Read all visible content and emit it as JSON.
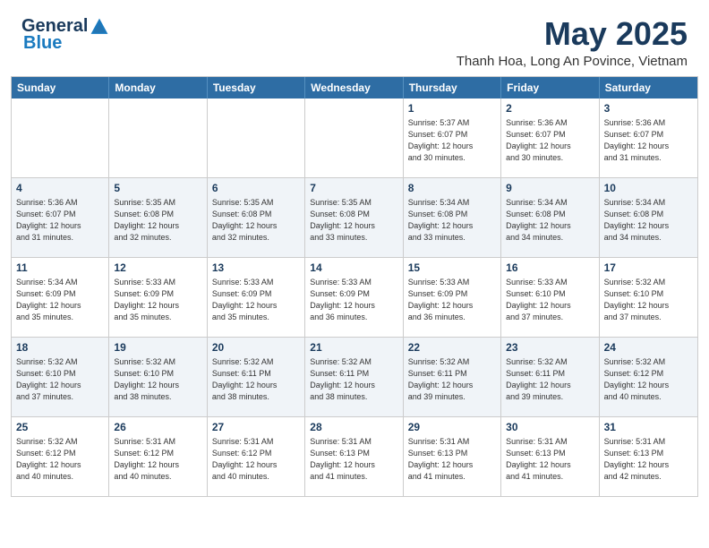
{
  "header": {
    "logo": {
      "general": "General",
      "blue": "Blue"
    },
    "title": "May 2025",
    "subtitle": "Thanh Hoa, Long An Povince, Vietnam"
  },
  "calendar": {
    "days_of_week": [
      "Sunday",
      "Monday",
      "Tuesday",
      "Wednesday",
      "Thursday",
      "Friday",
      "Saturday"
    ],
    "weeks": [
      [
        {
          "day": "",
          "info": ""
        },
        {
          "day": "",
          "info": ""
        },
        {
          "day": "",
          "info": ""
        },
        {
          "day": "",
          "info": ""
        },
        {
          "day": "1",
          "info": "Sunrise: 5:37 AM\nSunset: 6:07 PM\nDaylight: 12 hours\nand 30 minutes."
        },
        {
          "day": "2",
          "info": "Sunrise: 5:36 AM\nSunset: 6:07 PM\nDaylight: 12 hours\nand 30 minutes."
        },
        {
          "day": "3",
          "info": "Sunrise: 5:36 AM\nSunset: 6:07 PM\nDaylight: 12 hours\nand 31 minutes."
        }
      ],
      [
        {
          "day": "4",
          "info": "Sunrise: 5:36 AM\nSunset: 6:07 PM\nDaylight: 12 hours\nand 31 minutes."
        },
        {
          "day": "5",
          "info": "Sunrise: 5:35 AM\nSunset: 6:08 PM\nDaylight: 12 hours\nand 32 minutes."
        },
        {
          "day": "6",
          "info": "Sunrise: 5:35 AM\nSunset: 6:08 PM\nDaylight: 12 hours\nand 32 minutes."
        },
        {
          "day": "7",
          "info": "Sunrise: 5:35 AM\nSunset: 6:08 PM\nDaylight: 12 hours\nand 33 minutes."
        },
        {
          "day": "8",
          "info": "Sunrise: 5:34 AM\nSunset: 6:08 PM\nDaylight: 12 hours\nand 33 minutes."
        },
        {
          "day": "9",
          "info": "Sunrise: 5:34 AM\nSunset: 6:08 PM\nDaylight: 12 hours\nand 34 minutes."
        },
        {
          "day": "10",
          "info": "Sunrise: 5:34 AM\nSunset: 6:08 PM\nDaylight: 12 hours\nand 34 minutes."
        }
      ],
      [
        {
          "day": "11",
          "info": "Sunrise: 5:34 AM\nSunset: 6:09 PM\nDaylight: 12 hours\nand 35 minutes."
        },
        {
          "day": "12",
          "info": "Sunrise: 5:33 AM\nSunset: 6:09 PM\nDaylight: 12 hours\nand 35 minutes."
        },
        {
          "day": "13",
          "info": "Sunrise: 5:33 AM\nSunset: 6:09 PM\nDaylight: 12 hours\nand 35 minutes."
        },
        {
          "day": "14",
          "info": "Sunrise: 5:33 AM\nSunset: 6:09 PM\nDaylight: 12 hours\nand 36 minutes."
        },
        {
          "day": "15",
          "info": "Sunrise: 5:33 AM\nSunset: 6:09 PM\nDaylight: 12 hours\nand 36 minutes."
        },
        {
          "day": "16",
          "info": "Sunrise: 5:33 AM\nSunset: 6:10 PM\nDaylight: 12 hours\nand 37 minutes."
        },
        {
          "day": "17",
          "info": "Sunrise: 5:32 AM\nSunset: 6:10 PM\nDaylight: 12 hours\nand 37 minutes."
        }
      ],
      [
        {
          "day": "18",
          "info": "Sunrise: 5:32 AM\nSunset: 6:10 PM\nDaylight: 12 hours\nand 37 minutes."
        },
        {
          "day": "19",
          "info": "Sunrise: 5:32 AM\nSunset: 6:10 PM\nDaylight: 12 hours\nand 38 minutes."
        },
        {
          "day": "20",
          "info": "Sunrise: 5:32 AM\nSunset: 6:11 PM\nDaylight: 12 hours\nand 38 minutes."
        },
        {
          "day": "21",
          "info": "Sunrise: 5:32 AM\nSunset: 6:11 PM\nDaylight: 12 hours\nand 38 minutes."
        },
        {
          "day": "22",
          "info": "Sunrise: 5:32 AM\nSunset: 6:11 PM\nDaylight: 12 hours\nand 39 minutes."
        },
        {
          "day": "23",
          "info": "Sunrise: 5:32 AM\nSunset: 6:11 PM\nDaylight: 12 hours\nand 39 minutes."
        },
        {
          "day": "24",
          "info": "Sunrise: 5:32 AM\nSunset: 6:12 PM\nDaylight: 12 hours\nand 40 minutes."
        }
      ],
      [
        {
          "day": "25",
          "info": "Sunrise: 5:32 AM\nSunset: 6:12 PM\nDaylight: 12 hours\nand 40 minutes."
        },
        {
          "day": "26",
          "info": "Sunrise: 5:31 AM\nSunset: 6:12 PM\nDaylight: 12 hours\nand 40 minutes."
        },
        {
          "day": "27",
          "info": "Sunrise: 5:31 AM\nSunset: 6:12 PM\nDaylight: 12 hours\nand 40 minutes."
        },
        {
          "day": "28",
          "info": "Sunrise: 5:31 AM\nSunset: 6:13 PM\nDaylight: 12 hours\nand 41 minutes."
        },
        {
          "day": "29",
          "info": "Sunrise: 5:31 AM\nSunset: 6:13 PM\nDaylight: 12 hours\nand 41 minutes."
        },
        {
          "day": "30",
          "info": "Sunrise: 5:31 AM\nSunset: 6:13 PM\nDaylight: 12 hours\nand 41 minutes."
        },
        {
          "day": "31",
          "info": "Sunrise: 5:31 AM\nSunset: 6:13 PM\nDaylight: 12 hours\nand 42 minutes."
        }
      ]
    ]
  }
}
